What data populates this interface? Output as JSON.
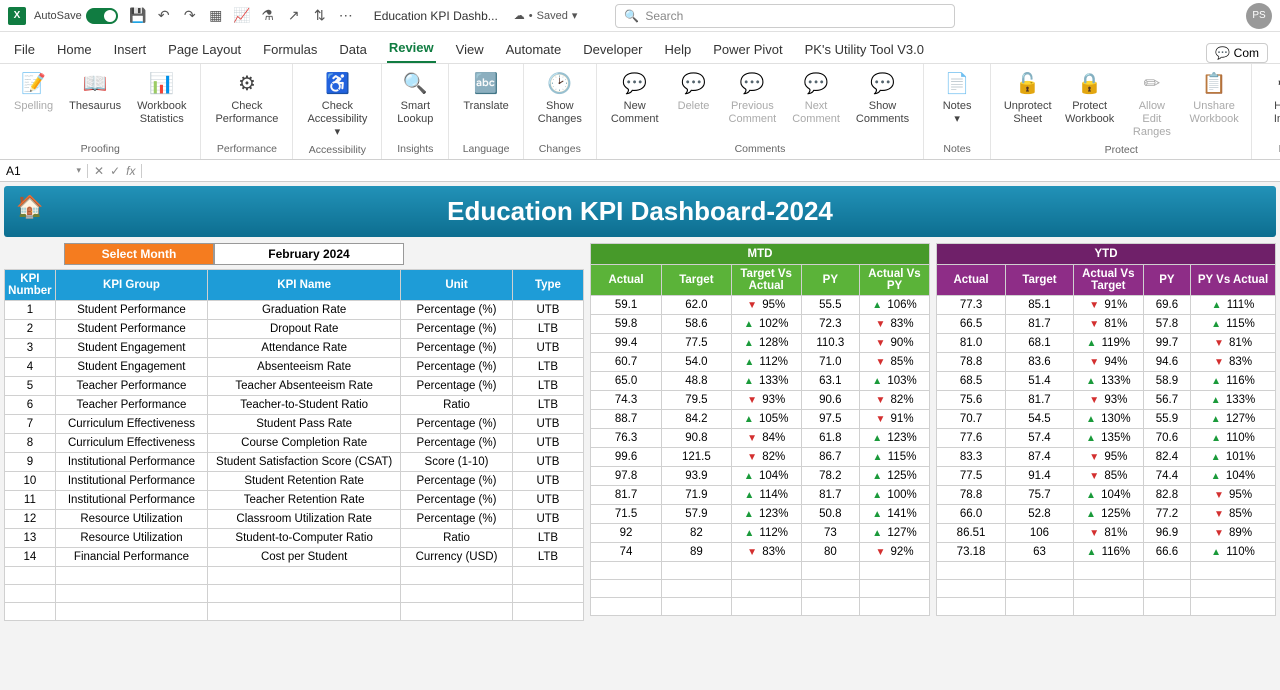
{
  "titlebar": {
    "autosave": "AutoSave",
    "docname": "Education KPI Dashb...",
    "saved": "Saved",
    "search_placeholder": "Search",
    "user_initials": "PS"
  },
  "tabs": {
    "items": [
      "File",
      "Home",
      "Insert",
      "Page Layout",
      "Formulas",
      "Data",
      "Review",
      "View",
      "Automate",
      "Developer",
      "Help",
      "Power Pivot",
      "PK's Utility Tool V3.0"
    ],
    "active_index": 6,
    "comments": "Com"
  },
  "ribbon": {
    "groups": [
      {
        "label": "Proofing",
        "buttons": [
          {
            "text": "Spelling",
            "disabled": true,
            "icon": "📝"
          },
          {
            "text": "Thesaurus",
            "icon": "📖"
          },
          {
            "text": "Workbook\nStatistics",
            "icon": "📊"
          }
        ]
      },
      {
        "label": "Performance",
        "buttons": [
          {
            "text": "Check\nPerformance",
            "icon": "⚙"
          }
        ]
      },
      {
        "label": "Accessibility",
        "buttons": [
          {
            "text": "Check\nAccessibility ▾",
            "icon": "♿"
          }
        ]
      },
      {
        "label": "Insights",
        "buttons": [
          {
            "text": "Smart\nLookup",
            "icon": "🔍"
          }
        ]
      },
      {
        "label": "Language",
        "buttons": [
          {
            "text": "Translate",
            "icon": "🔤"
          }
        ]
      },
      {
        "label": "Changes",
        "buttons": [
          {
            "text": "Show\nChanges",
            "icon": "🕑"
          }
        ]
      },
      {
        "label": "Comments",
        "buttons": [
          {
            "text": "New\nComment",
            "icon": "💬"
          },
          {
            "text": "Delete",
            "disabled": true,
            "icon": "💬"
          },
          {
            "text": "Previous\nComment",
            "disabled": true,
            "icon": "💬"
          },
          {
            "text": "Next\nComment",
            "disabled": true,
            "icon": "💬"
          },
          {
            "text": "Show\nComments",
            "icon": "💬"
          }
        ]
      },
      {
        "label": "Notes",
        "buttons": [
          {
            "text": "Notes\n▾",
            "icon": "📄"
          }
        ]
      },
      {
        "label": "Protect",
        "buttons": [
          {
            "text": "Unprotect\nSheet",
            "icon": "🔓"
          },
          {
            "text": "Protect\nWorkbook",
            "icon": "🔒"
          },
          {
            "text": "Allow Edit\nRanges",
            "disabled": true,
            "icon": "✏"
          },
          {
            "text": "Unshare\nWorkbook",
            "disabled": true,
            "icon": "📋"
          }
        ]
      },
      {
        "label": "Ink",
        "buttons": [
          {
            "text": "Hide\nInk ▾",
            "icon": "✒"
          }
        ]
      }
    ]
  },
  "namebox": "A1",
  "dashboard": {
    "title": "Education KPI Dashboard-2024",
    "select_month_label": "Select Month",
    "selected_month": "February 2024",
    "mtd_label": "MTD",
    "ytd_label": "YTD",
    "left_headers": [
      "KPI\nNumber",
      "KPI Group",
      "KPI Name",
      "Unit",
      "Type"
    ],
    "mtd_headers": [
      "Actual",
      "Target",
      "Target Vs\nActual",
      "PY",
      "Actual Vs\nPY"
    ],
    "ytd_headers": [
      "Actual",
      "Target",
      "Actual Vs\nTarget",
      "PY",
      "PY Vs Actual"
    ],
    "rows": [
      {
        "num": "1",
        "group": "Student Performance",
        "name": "Graduation Rate",
        "unit": "Percentage (%)",
        "type": "UTB",
        "m_actual": "59.1",
        "m_target": "62.0",
        "m_tva": "95%",
        "m_tva_dir": "down",
        "m_py": "55.5",
        "m_avpy": "106%",
        "m_avpy_dir": "up",
        "y_actual": "77.3",
        "y_target": "85.1",
        "y_avt": "91%",
        "y_avt_dir": "down",
        "y_py": "69.6",
        "y_pva": "111%",
        "y_pva_dir": "up"
      },
      {
        "num": "2",
        "group": "Student Performance",
        "name": "Dropout Rate",
        "unit": "Percentage (%)",
        "type": "LTB",
        "m_actual": "59.8",
        "m_target": "58.6",
        "m_tva": "102%",
        "m_tva_dir": "up",
        "m_py": "72.3",
        "m_avpy": "83%",
        "m_avpy_dir": "down",
        "y_actual": "66.5",
        "y_target": "81.7",
        "y_avt": "81%",
        "y_avt_dir": "down",
        "y_py": "57.8",
        "y_pva": "115%",
        "y_pva_dir": "up"
      },
      {
        "num": "3",
        "group": "Student Engagement",
        "name": "Attendance Rate",
        "unit": "Percentage (%)",
        "type": "UTB",
        "m_actual": "99.4",
        "m_target": "77.5",
        "m_tva": "128%",
        "m_tva_dir": "up",
        "m_py": "110.3",
        "m_avpy": "90%",
        "m_avpy_dir": "down",
        "y_actual": "81.0",
        "y_target": "68.1",
        "y_avt": "119%",
        "y_avt_dir": "up",
        "y_py": "99.7",
        "y_pva": "81%",
        "y_pva_dir": "down"
      },
      {
        "num": "4",
        "group": "Student Engagement",
        "name": "Absenteeism Rate",
        "unit": "Percentage (%)",
        "type": "LTB",
        "m_actual": "60.7",
        "m_target": "54.0",
        "m_tva": "112%",
        "m_tva_dir": "up",
        "m_py": "71.0",
        "m_avpy": "85%",
        "m_avpy_dir": "down",
        "y_actual": "78.8",
        "y_target": "83.6",
        "y_avt": "94%",
        "y_avt_dir": "down",
        "y_py": "94.6",
        "y_pva": "83%",
        "y_pva_dir": "down"
      },
      {
        "num": "5",
        "group": "Teacher Performance",
        "name": "Teacher Absenteeism Rate",
        "unit": "Percentage (%)",
        "type": "LTB",
        "m_actual": "65.0",
        "m_target": "48.8",
        "m_tva": "133%",
        "m_tva_dir": "up",
        "m_py": "63.1",
        "m_avpy": "103%",
        "m_avpy_dir": "up",
        "y_actual": "68.5",
        "y_target": "51.4",
        "y_avt": "133%",
        "y_avt_dir": "up",
        "y_py": "58.9",
        "y_pva": "116%",
        "y_pva_dir": "up"
      },
      {
        "num": "6",
        "group": "Teacher Performance",
        "name": "Teacher-to-Student Ratio",
        "unit": "Ratio",
        "type": "LTB",
        "m_actual": "74.3",
        "m_target": "79.5",
        "m_tva": "93%",
        "m_tva_dir": "down",
        "m_py": "90.6",
        "m_avpy": "82%",
        "m_avpy_dir": "down",
        "y_actual": "75.6",
        "y_target": "81.7",
        "y_avt": "93%",
        "y_avt_dir": "down",
        "y_py": "56.7",
        "y_pva": "133%",
        "y_pva_dir": "up"
      },
      {
        "num": "7",
        "group": "Curriculum Effectiveness",
        "name": "Student Pass Rate",
        "unit": "Percentage (%)",
        "type": "UTB",
        "m_actual": "88.7",
        "m_target": "84.2",
        "m_tva": "105%",
        "m_tva_dir": "up",
        "m_py": "97.5",
        "m_avpy": "91%",
        "m_avpy_dir": "down",
        "y_actual": "70.7",
        "y_target": "54.5",
        "y_avt": "130%",
        "y_avt_dir": "up",
        "y_py": "55.9",
        "y_pva": "127%",
        "y_pva_dir": "up"
      },
      {
        "num": "8",
        "group": "Curriculum Effectiveness",
        "name": "Course Completion Rate",
        "unit": "Percentage (%)",
        "type": "UTB",
        "m_actual": "76.3",
        "m_target": "90.8",
        "m_tva": "84%",
        "m_tva_dir": "down",
        "m_py": "61.8",
        "m_avpy": "123%",
        "m_avpy_dir": "up",
        "y_actual": "77.6",
        "y_target": "57.4",
        "y_avt": "135%",
        "y_avt_dir": "up",
        "y_py": "70.6",
        "y_pva": "110%",
        "y_pva_dir": "up"
      },
      {
        "num": "9",
        "group": "Institutional Performance",
        "name": "Student Satisfaction Score (CSAT)",
        "unit": "Score (1-10)",
        "type": "UTB",
        "m_actual": "99.6",
        "m_target": "121.5",
        "m_tva": "82%",
        "m_tva_dir": "down",
        "m_py": "86.7",
        "m_avpy": "115%",
        "m_avpy_dir": "up",
        "y_actual": "83.3",
        "y_target": "87.4",
        "y_avt": "95%",
        "y_avt_dir": "down",
        "y_py": "82.4",
        "y_pva": "101%",
        "y_pva_dir": "up"
      },
      {
        "num": "10",
        "group": "Institutional Performance",
        "name": "Student Retention Rate",
        "unit": "Percentage (%)",
        "type": "UTB",
        "m_actual": "97.8",
        "m_target": "93.9",
        "m_tva": "104%",
        "m_tva_dir": "up",
        "m_py": "78.2",
        "m_avpy": "125%",
        "m_avpy_dir": "up",
        "y_actual": "77.5",
        "y_target": "91.4",
        "y_avt": "85%",
        "y_avt_dir": "down",
        "y_py": "74.4",
        "y_pva": "104%",
        "y_pva_dir": "up"
      },
      {
        "num": "11",
        "group": "Institutional Performance",
        "name": "Teacher Retention Rate",
        "unit": "Percentage (%)",
        "type": "UTB",
        "m_actual": "81.7",
        "m_target": "71.9",
        "m_tva": "114%",
        "m_tva_dir": "up",
        "m_py": "81.7",
        "m_avpy": "100%",
        "m_avpy_dir": "up",
        "y_actual": "78.8",
        "y_target": "75.7",
        "y_avt": "104%",
        "y_avt_dir": "up",
        "y_py": "82.8",
        "y_pva": "95%",
        "y_pva_dir": "down"
      },
      {
        "num": "12",
        "group": "Resource Utilization",
        "name": "Classroom Utilization Rate",
        "unit": "Percentage (%)",
        "type": "UTB",
        "m_actual": "71.5",
        "m_target": "57.9",
        "m_tva": "123%",
        "m_tva_dir": "up",
        "m_py": "50.8",
        "m_avpy": "141%",
        "m_avpy_dir": "up",
        "y_actual": "66.0",
        "y_target": "52.8",
        "y_avt": "125%",
        "y_avt_dir": "up",
        "y_py": "77.2",
        "y_pva": "85%",
        "y_pva_dir": "down"
      },
      {
        "num": "13",
        "group": "Resource Utilization",
        "name": "Student-to-Computer Ratio",
        "unit": "Ratio",
        "type": "LTB",
        "m_actual": "92",
        "m_target": "82",
        "m_tva": "112%",
        "m_tva_dir": "up",
        "m_py": "73",
        "m_avpy": "127%",
        "m_avpy_dir": "up",
        "y_actual": "86.51",
        "y_target": "106",
        "y_avt": "81%",
        "y_avt_dir": "down",
        "y_py": "96.9",
        "y_pva": "89%",
        "y_pva_dir": "down"
      },
      {
        "num": "14",
        "group": "Financial Performance",
        "name": "Cost per Student",
        "unit": "Currency (USD)",
        "type": "LTB",
        "m_actual": "74",
        "m_target": "89",
        "m_tva": "83%",
        "m_tva_dir": "down",
        "m_py": "80",
        "m_avpy": "92%",
        "m_avpy_dir": "down",
        "y_actual": "73.18",
        "y_target": "63",
        "y_avt": "116%",
        "y_avt_dir": "up",
        "y_py": "66.6",
        "y_pva": "110%",
        "y_pva_dir": "up"
      }
    ]
  }
}
